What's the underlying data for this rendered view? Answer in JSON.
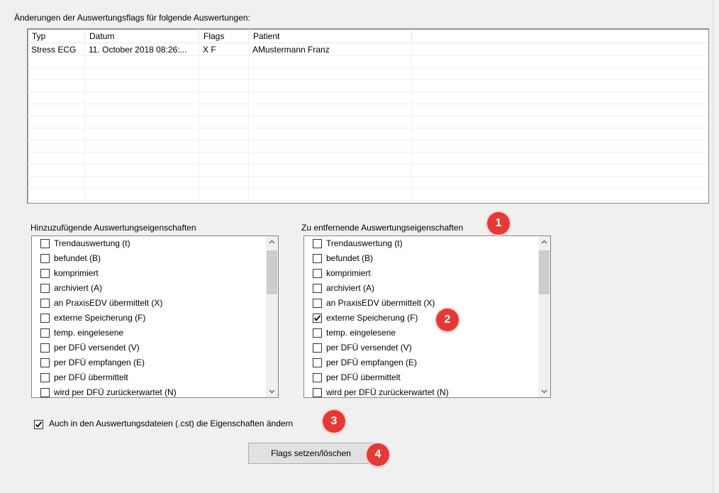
{
  "changes_label": "Änderungen der Auswertungsflags für folgende Auswertungen:",
  "table": {
    "columns": [
      "Typ",
      "Datum",
      "Flags",
      "Patient"
    ],
    "rows": [
      [
        "Stress ECG",
        "11. October 2018 08:26:...",
        "X F",
        "AMustermann Franz"
      ]
    ],
    "empty_rows": 12
  },
  "add_group": {
    "label": "Hinzuzufügende Auswertungseigenschaften",
    "items": [
      {
        "label": "Trendauswertung (t)",
        "checked": false
      },
      {
        "label": "befundet (B)",
        "checked": false
      },
      {
        "label": "komprimiert",
        "checked": false
      },
      {
        "label": "archiviert (A)",
        "checked": false
      },
      {
        "label": "an PraxisEDV übermittelt (X)",
        "checked": false
      },
      {
        "label": "externe Speicherung (F)",
        "checked": false
      },
      {
        "label": "temp. eingelesene",
        "checked": false
      },
      {
        "label": "per DFÜ versendet (V)",
        "checked": false
      },
      {
        "label": "per DFÜ empfangen (E)",
        "checked": false
      },
      {
        "label": "per DFÜ übermittelt",
        "checked": false
      },
      {
        "label": "wird per DFÜ zurückerwartet (N)",
        "checked": false
      }
    ]
  },
  "remove_group": {
    "label": "Zu entfernende Auswertungseigenschaften",
    "items": [
      {
        "label": "Trendauswertung (t)",
        "checked": false
      },
      {
        "label": "befundet (B)",
        "checked": false
      },
      {
        "label": "komprimiert",
        "checked": false
      },
      {
        "label": "archiviert (A)",
        "checked": false
      },
      {
        "label": "an PraxisEDV übermittelt (X)",
        "checked": false
      },
      {
        "label": "externe Speicherung (F)",
        "checked": true
      },
      {
        "label": "temp. eingelesene",
        "checked": false
      },
      {
        "label": "per DFÜ versendet (V)",
        "checked": false
      },
      {
        "label": "per DFÜ empfangen (E)",
        "checked": false
      },
      {
        "label": "per DFÜ übermittelt",
        "checked": false
      },
      {
        "label": "wird per DFÜ zurückerwartet (N)",
        "checked": false
      }
    ]
  },
  "also_change_files": {
    "label": "Auch in den Auswertungsdateien (.cst) die Eigenschaften ändern",
    "checked": true
  },
  "button_label": "Flags setzen/löschen",
  "badges": [
    "1",
    "2",
    "3",
    "4"
  ],
  "colors": {
    "badge": "#e53935",
    "border": "#828790"
  }
}
